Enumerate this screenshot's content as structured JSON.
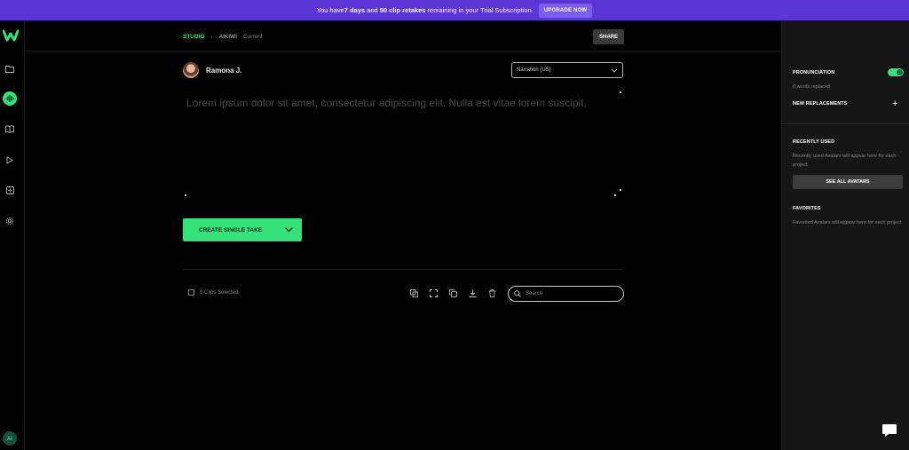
{
  "banner": {
    "text_pre": "You have ",
    "days": "7 days",
    "text_mid": " and ",
    "retakes": "50 clip retakes",
    "text_post": " remaining in your Trial Subscription.",
    "upgrade_label": "UPGRADE NOW"
  },
  "rail": {
    "items": [
      {
        "icon": "folder-icon"
      },
      {
        "icon": "waveform-icon",
        "active": true
      },
      {
        "icon": "book-icon"
      },
      {
        "icon": "play-icon"
      },
      {
        "icon": "media-icon"
      },
      {
        "icon": "gear-icon"
      }
    ],
    "user_initials": "AI"
  },
  "breadcrumb": {
    "root": "STUDIO",
    "separator": "›",
    "project": "AIKIWI",
    "current": "Current"
  },
  "share_label": "SHARE",
  "speaker": {
    "name": "Ramona J."
  },
  "voice_select": {
    "value": "Narration (US)"
  },
  "editor": {
    "placeholder": "Lorem ipsum dolor sit amet, consectetur adipiscing elit. Nulla est vitae lorem suscipit,"
  },
  "create_button": {
    "label": "CREATE SINGLE TAKE"
  },
  "clips": {
    "selected_label": "0 Clips Selected"
  },
  "search": {
    "placeholder": "Search"
  },
  "sidebar": {
    "pronunciation_title": "PRONUNCIATION",
    "pronunciation_enabled": true,
    "words_replaced": "0 words replaced",
    "new_replacements": "NEW REPLACEMENTS",
    "recently_used_title": "RECENTLY USED",
    "recently_used_text": "Recently used Avatars will appear here for each project",
    "see_all_label": "SEE ALL AVATARS",
    "favorites_title": "FAVORITES",
    "favorites_text": "Favorited Avatars will appear here for each project"
  },
  "colors": {
    "accent": "#35e27a",
    "banner": "#5b35d5",
    "background": "#000000",
    "sidebar": "#161616"
  }
}
